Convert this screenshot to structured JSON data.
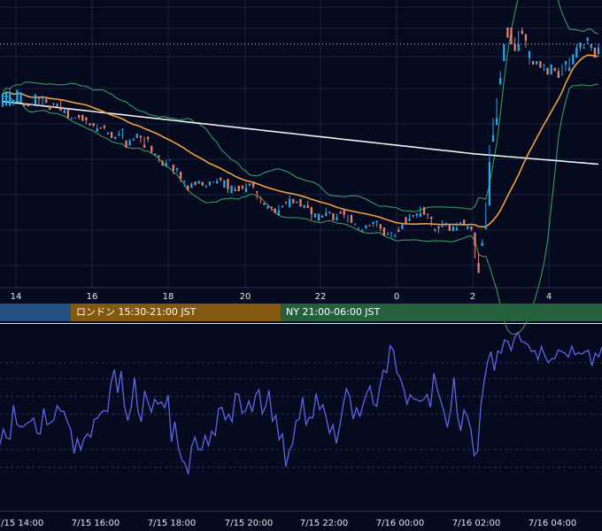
{
  "chart_data": [
    {
      "type": "candlestick",
      "x_axis": {
        "tick_labels": [
          "14",
          "16",
          "18",
          "20",
          "22",
          "0",
          "2",
          "4"
        ]
      },
      "y_axis": {
        "tick_labels": []
      },
      "grid": true,
      "reference_line": "dotted horizontal at latest price",
      "series": [
        {
          "kind": "candles",
          "up_color": "#26a8f0",
          "down_color": "#e8826e"
        },
        {
          "kind": "moving_average",
          "color": "#f0a040"
        },
        {
          "kind": "moving_average",
          "color": "#f0f0f0"
        },
        {
          "kind": "bollinger_band",
          "color": "#3fa56a"
        }
      ],
      "ohlc": [
        [
          14,
          53,
          15
        ],
        [
          18,
          60,
          45
        ],
        [
          17,
          57,
          70
        ],
        [
          20,
          35,
          35
        ],
        [
          28,
          64,
          53
        ],
        [
          27,
          57,
          48
        ],
        [
          25,
          17,
          22
        ],
        [
          21,
          15,
          17
        ],
        [
          19,
          20,
          22
        ],
        [
          21,
          51,
          37
        ],
        [
          44,
          38,
          16
        ],
        [
          38,
          46,
          20
        ],
        [
          38,
          26,
          33
        ],
        [
          18,
          5,
          13
        ],
        [
          25,
          22,
          11
        ],
        [
          15,
          23,
          25
        ],
        [
          9,
          2,
          37
        ],
        [
          -5,
          4,
          7
        ],
        [
          5,
          -19,
          -19
        ],
        [
          -23,
          -20,
          -16
        ],
        [
          -18,
          -18,
          -19
        ],
        [
          -10,
          -18,
          -24
        ],
        [
          -10,
          -28,
          -26
        ],
        [
          -17,
          -26,
          -38
        ],
        [
          -35,
          -41,
          -42
        ],
        [
          -35,
          -42,
          -45
        ],
        [
          -60,
          -50,
          -38
        ],
        [
          -47,
          -51,
          -47
        ],
        [
          -41,
          -48,
          -54
        ],
        [
          -68,
          -64,
          -60
        ],
        [
          -61,
          -79,
          -77
        ],
        [
          -82,
          -75,
          -77
        ],
        [
          -72,
          -67,
          -56
        ],
        [
          -55,
          -51,
          -82
        ],
        [
          -86,
          -108,
          -90
        ],
        [
          -101,
          -86,
          -81
        ],
        [
          -86,
          -82,
          -78
        ],
        [
          -79,
          -66,
          -70
        ],
        [
          -72,
          -77,
          -93
        ],
        [
          -99,
          -108,
          -75
        ],
        [
          -75,
          -82,
          -91
        ],
        [
          -102,
          -120,
          -124
        ],
        [
          -130,
          -125,
          -124
        ],
        [
          -130,
          -134,
          -151
        ],
        [
          -146,
          -161,
          -159
        ],
        [
          -164,
          -153,
          -144
        ],
        [
          -143,
          -143,
          -146
        ],
        [
          -158,
          -175,
          -187
        ],
        [
          -174,
          -168,
          -182
        ],
        [
          -179,
          -200,
          -210
        ],
        [
          -205,
          -205,
          -223
        ],
        [
          -220,
          -234,
          -230
        ],
        [
          -227,
          -214,
          -210
        ],
        [
          -209,
          -219,
          -208
        ],
        [
          -215,
          -206,
          -210
        ],
        [
          -209,
          -220,
          -222
        ],
        [
          -226,
          -223,
          -217
        ],
        [
          -220,
          -208,
          -209
        ],
        [
          -209,
          -211,
          -211
        ],
        [
          -214,
          -206,
          -199
        ],
        [
          -196,
          -204,
          -208
        ],
        [
          -226,
          -204,
          -207
        ],
        [
          -200,
          -231,
          -243
        ],
        [
          -243,
          -220,
          -227
        ],
        [
          -232,
          -237,
          -223
        ],
        [
          -221,
          -237,
          -228
        ],
        [
          -220,
          -228,
          -233
        ],
        [
          -240,
          -227,
          -213
        ],
        [
          -221,
          -214,
          -220
        ],
        [
          -208,
          -224,
          -230
        ],
        [
          -237,
          -241,
          -261
        ],
        [
          -255,
          -258,
          -273
        ],
        [
          -272,
          -278,
          -274
        ],
        [
          -289,
          -281,
          -279
        ],
        [
          -283,
          -287,
          -295
        ],
        [
          -288,
          -303,
          -298
        ],
        [
          -309,
          -294,
          -278
        ],
        [
          -285,
          -280,
          -285
        ],
        [
          -268,
          -271,
          -277
        ],
        [
          -285,
          -260,
          -249
        ],
        [
          -260,
          -273,
          -265
        ],
        [
          -272,
          -267,
          -270
        ],
        [
          -260,
          -283,
          -272
        ],
        [
          -286,
          -278,
          -289
        ],
        [
          -279,
          -287,
          -266
        ],
        [
          -284,
          -305,
          -322
        ],
        [
          -315,
          -303,
          -307
        ],
        [
          -325,
          -304,
          -306
        ],
        [
          -309,
          -315,
          -314
        ],
        [
          -311,
          -301,
          -286
        ],
        [
          -298,
          -299,
          -305
        ],
        [
          -303,
          -324,
          -321
        ],
        [
          -324,
          -315,
          -304
        ],
        [
          -299,
          -304,
          -295
        ],
        [
          -290,
          -307,
          -319
        ],
        [
          -327,
          -325,
          -307
        ],
        [
          -307,
          -331,
          -332
        ],
        [
          -336,
          -333,
          -339
        ],
        [
          -346,
          -345,
          -355
        ],
        [
          -357,
          -353,
          -350
        ],
        [
          -348,
          -338,
          -348
        ],
        [
          -338,
          -341,
          -336
        ],
        [
          -334,
          -328,
          -344
        ],
        [
          -329,
          -325,
          -344
        ],
        [
          -335,
          -348,
          -357
        ],
        [
          -345,
          -369,
          -354
        ],
        [
          -367,
          -363,
          -358
        ],
        [
          -361,
          -359,
          -375
        ],
        [
          -373,
          -370,
          -363
        ],
        [
          -352,
          -358,
          -343
        ],
        [
          -350,
          -333,
          -344
        ],
        [
          -314,
          -335,
          -321
        ],
        [
          -326,
          -318,
          -304
        ],
        [
          -308,
          -311,
          -316
        ],
        [
          -308,
          -303,
          -317
        ],
        [
          -313,
          -302,
          -281
        ],
        [
          -284,
          -307,
          -305
        ],
        [
          -304,
          -305,
          -320
        ],
        [
          -313,
          -319,
          -341
        ],
        [
          -354,
          -349,
          -359
        ],
        [
          -341,
          -347,
          -362
        ],
        [
          -344,
          -339,
          -323
        ],
        [
          -331,
          -331,
          -342
        ],
        [
          -337,
          -355,
          -345
        ],
        [
          -356,
          -342,
          -340
        ],
        [
          -354,
          -347,
          -330
        ],
        [
          -333,
          -329,
          -337
        ],
        [
          -322,
          -337,
          -329
        ],
        [
          -350,
          -342,
          -336
        ],
        [
          -342,
          -350,
          -356
        ],
        [
          -360,
          -399,
          -437
        ],
        [
          -450,
          -480,
          -420
        ],
        [
          -400,
          -390,
          -380
        ],
        [
          -350,
          -340,
          -270
        ],
        [
          -280,
          -150,
          -100
        ],
        [
          -90,
          -70,
          -20
        ],
        [
          -40,
          -20,
          40
        ],
        [
          80,
          100,
          120
        ],
        [
          150,
          200,
          200
        ],
        [
          250,
          220,
          230
        ],
        [
          250,
          200,
          220
        ],
        [
          200,
          180,
          220
        ],
        [
          180,
          200,
          240
        ],
        [
          240,
          230,
          250
        ],
        [
          230,
          210,
          190
        ],
        [
          160,
          180,
          140
        ],
        [
          150,
          140,
          140
        ],
        [
          140,
          150,
          150
        ],
        [
          150,
          130,
          150
        ],
        [
          140,
          140,
          120
        ],
        [
          130,
          110,
          110
        ],
        [
          110,
          140,
          120
        ],
        [
          130,
          120,
          120
        ],
        [
          120,
          100,
          130
        ],
        [
          110,
          110,
          140
        ],
        [
          140,
          150,
          120
        ],
        [
          120,
          130,
          160
        ],
        [
          140,
          170,
          150
        ],
        [
          160,
          190,
          200
        ],
        [
          190,
          205,
          180
        ],
        [
          190,
          190,
          200
        ],
        [
          210,
          220,
          200
        ],
        [
          190,
          200,
          180
        ],
        [
          190,
          160,
          180
        ],
        [
          170,
          190,
          200
        ]
      ]
    },
    {
      "type": "line",
      "x_axis": {
        "tick_labels": [
          "7/15 14:00",
          "7/15 16:00",
          "7/15 18:00",
          "7/15 20:00",
          "7/15 22:00",
          "7/16 00:00",
          "7/16 02:00",
          "7/16 04:00"
        ]
      },
      "y_axis": {
        "tick_labels": []
      },
      "series": [
        {
          "color": "#5b66e6",
          "values": [
            44.3,
            47.2,
            45.5,
            45.3,
            51.7,
            48.1,
            47.6,
            47.7,
            48.3,
            48.6,
            49.3,
            46.4,
            46.3,
            51.1,
            48.0,
            48.4,
            48.9,
            51.6,
            50.6,
            50.5,
            48.6,
            47.2,
            42.6,
            45.4,
            43.3,
            45.4,
            46.3,
            45.7,
            49.0,
            49.3,
            50.3,
            50.7,
            50.5,
            55.9,
            58.4,
            54.0,
            58.1,
            51.5,
            48.8,
            51.3,
            56.9,
            50.6,
            48.6,
            54.4,
            52.2,
            50.4,
            52.8,
            51.9,
            52.3,
            51.2,
            53.6,
            44.8,
            48.6,
            43.9,
            41.5,
            40.7,
            38.7,
            44.0,
            45.7,
            43.3,
            43.3,
            46.0,
            44.1,
            46.8,
            46.0,
            51.0,
            51.3,
            48.9,
            50.0,
            48.6,
            53.9,
            53.7,
            50.2,
            50.6,
            52.5,
            50.4,
            53.6,
            54.6,
            50.1,
            51.5,
            54.5,
            48.7,
            49.8,
            45.2,
            46.3,
            40.1,
            43.1,
            44.4,
            48.7,
            49.1,
            53.2,
            48.0,
            49.4,
            49.3,
            53.9,
            50.9,
            51.8,
            49.3,
            46.4,
            48.0,
            44.5,
            47.6,
            51.6,
            54.8,
            53.3,
            49.1,
            51.2,
            49.6,
            51.9,
            53.9,
            55.3,
            52.0,
            51.5,
            55.4,
            58.3,
            57.8,
            62.9,
            62.0,
            57.8,
            56.8,
            54.9,
            51.9,
            53.7,
            52.9,
            52.7,
            52.4,
            52.8,
            53.7,
            51.3,
            57.7,
            54.7,
            52.6,
            50.5,
            47.5,
            50.8,
            56.9,
            49.8,
            46.9,
            50.8,
            49.5,
            47.2,
            42.2,
            43.0,
            51.7,
            56.3,
            59.9,
            61.8,
            58.2,
            61.9,
            61.5,
            64.0,
            63.7,
            62.0,
            64.4,
            65.4,
            63.7,
            63.5,
            63.1,
            61.8,
            62.0,
            60.3,
            62.7,
            61.0,
            59.7,
            60.4,
            60.5,
            62.1,
            61.8,
            61.5,
            60.7,
            62.8,
            61.2,
            61.6,
            61.3,
            61.8,
            62.0,
            59.1,
            61.5,
            60.8,
            62.6
          ]
        }
      ]
    }
  ],
  "sessions": [
    {
      "label": "",
      "color": "#234f82"
    },
    {
      "label": "ロンドン 15:30-21:00 JST",
      "color": "#83580f"
    },
    {
      "label": "NY 21:00-06:00 JST",
      "color": "#25603c"
    }
  ]
}
